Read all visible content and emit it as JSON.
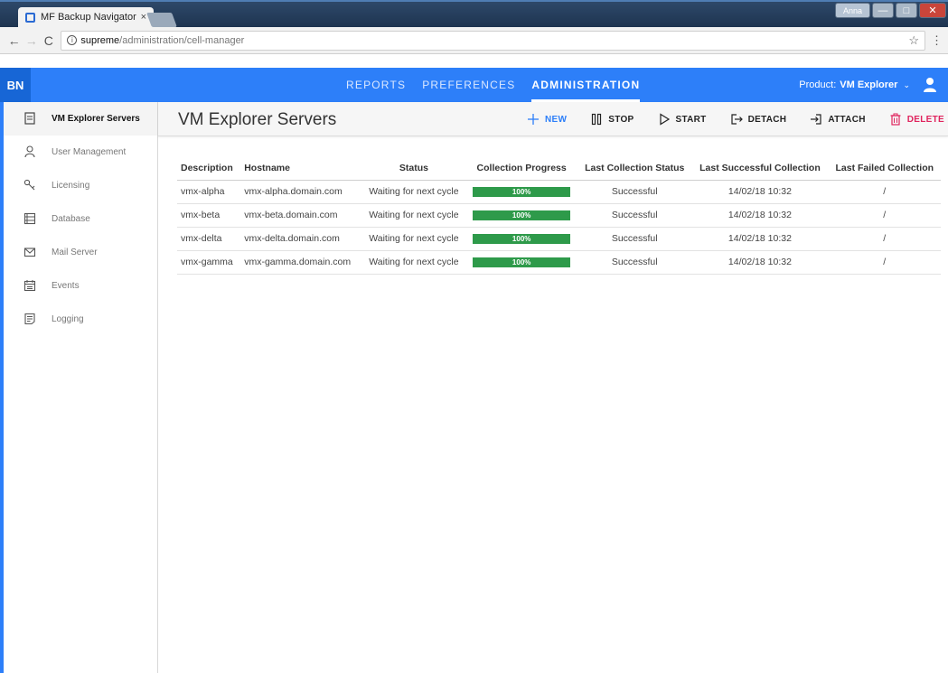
{
  "browser": {
    "tab_title": "MF Backup Navigator",
    "tab_close": "×",
    "url_host": "supreme",
    "url_path": "/administration/cell-manager",
    "profile_name": "Anna",
    "info_glyph": "i",
    "back_glyph": "←",
    "forward_glyph": "→",
    "reload_glyph": "C",
    "star_glyph": "☆",
    "menu_glyph": "⋮",
    "minimize_glyph": "—",
    "maximize_glyph": "□",
    "close_glyph": "✕"
  },
  "app": {
    "logo": "BN",
    "nav": [
      {
        "label": "REPORTS",
        "active": false
      },
      {
        "label": "PREFERENCES",
        "active": false
      },
      {
        "label": "ADMINISTRATION",
        "active": true
      }
    ],
    "product_label": "Product:",
    "product_value": "VM Explorer",
    "colors": {
      "header": "#2d7ff9",
      "logo_bg": "#1766d6",
      "progress": "#2e9a4a",
      "delete": "#e0245e"
    }
  },
  "sidebar": {
    "items": [
      {
        "label": "VM Explorer Servers",
        "icon": "server-list-icon",
        "active": true
      },
      {
        "label": "User Management",
        "icon": "user-icon",
        "active": false
      },
      {
        "label": "Licensing",
        "icon": "key-icon",
        "active": false
      },
      {
        "label": "Database",
        "icon": "database-icon",
        "active": false
      },
      {
        "label": "Mail Server",
        "icon": "mail-icon",
        "active": false
      },
      {
        "label": "Events",
        "icon": "calendar-icon",
        "active": false
      },
      {
        "label": "Logging",
        "icon": "log-icon",
        "active": false
      }
    ]
  },
  "main": {
    "title": "VM Explorer Servers",
    "toolbar": {
      "new": "NEW",
      "stop": "STOP",
      "start": "START",
      "detach": "DETACH",
      "attach": "ATTACH",
      "delete": "DELETE"
    },
    "table": {
      "columns": [
        "Description",
        "Hostname",
        "Status",
        "Collection Progress",
        "Last Collection Status",
        "Last Successful Collection",
        "Last Failed Collection"
      ],
      "rows": [
        {
          "description": "vmx-alpha",
          "hostname": "vmx-alpha.domain.com",
          "status": "Waiting for next cycle",
          "progress": "100%",
          "last_status": "Successful",
          "last_success": "14/02/18 10:32",
          "last_failed": "/"
        },
        {
          "description": "vmx-beta",
          "hostname": "vmx-beta.domain.com",
          "status": "Waiting for next cycle",
          "progress": "100%",
          "last_status": "Successful",
          "last_success": "14/02/18 10:32",
          "last_failed": "/"
        },
        {
          "description": "vmx-delta",
          "hostname": "vmx-delta.domain.com",
          "status": "Waiting for next cycle",
          "progress": "100%",
          "last_status": "Successful",
          "last_success": "14/02/18 10:32",
          "last_failed": "/"
        },
        {
          "description": "vmx-gamma",
          "hostname": "vmx-gamma.domain.com",
          "status": "Waiting for next cycle",
          "progress": "100%",
          "last_status": "Successful",
          "last_success": "14/02/18 10:32",
          "last_failed": "/"
        }
      ]
    }
  }
}
